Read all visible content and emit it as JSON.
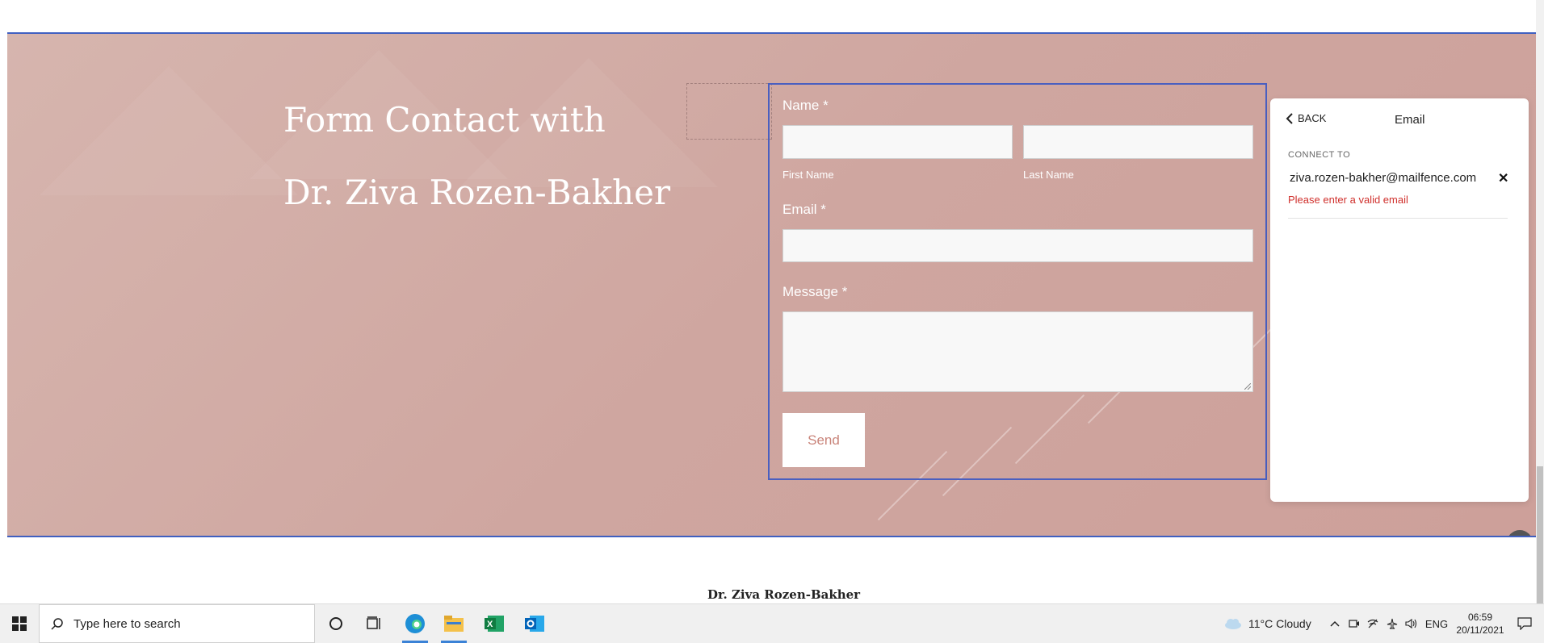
{
  "hero": {
    "heading_line1": "Form Contact with",
    "heading_line2": "Dr. Ziva Rozen-Bakher"
  },
  "form": {
    "name_label": "Name *",
    "first_name_label": "First Name",
    "last_name_label": "Last Name",
    "email_label": "Email *",
    "message_label": "Message *",
    "send_label": "Send"
  },
  "panel": {
    "back_label": "BACK",
    "title": "Email",
    "connect_label": "CONNECT TO",
    "email_value": "ziva.rozen-bakher@mailfence.com",
    "error_text": "Please enter a valid email"
  },
  "footer": {
    "name": "Dr. Ziva Rozen-Bakher"
  },
  "taskbar": {
    "search_placeholder": "Type here to search",
    "weather": "11°C  Cloudy",
    "language": "ENG",
    "time": "06:59",
    "date": "20/11/2021"
  },
  "colors": {
    "section_bg": "#cfa6a0",
    "selection_border": "#4a5fc0",
    "error": "#d0312d",
    "send_text": "#c9847a"
  }
}
